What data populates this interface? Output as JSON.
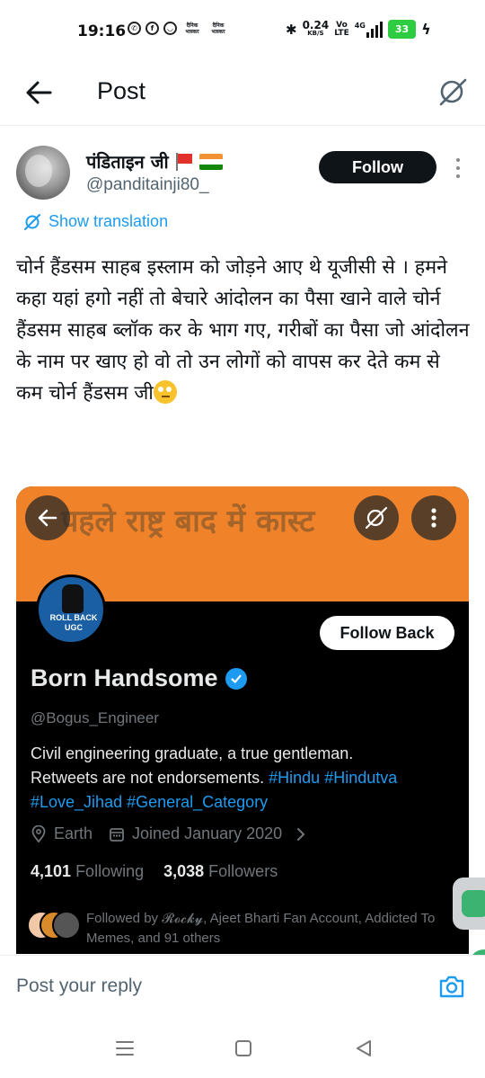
{
  "status_bar": {
    "time": "19:16",
    "net_speed": "0.24",
    "net_unit": "KB/S",
    "vo": "Vo",
    "lte": "LTE",
    "net_type": "4G",
    "battery": "33",
    "mini_app_label": "दैनिक भास्कर"
  },
  "header": {
    "title": "Post"
  },
  "post": {
    "author_name": "पंडिताइन जी",
    "author_handle": "@panditainji80_",
    "follow_label": "Follow",
    "show_translation": "Show translation",
    "text": "चोर्न हैंडसम साहब इस्लाम को जोड़ने आए थे यूजीसी से । हमने कहा यहां हगो नहीं तो बेचारे आंदोलन का पैसा खाने वाले चोर्न हैंडसम साहब ब्लॉक कर के भाग गए, गरीबों का पैसा जो आंदोलन के नाम पर खाए हो वो तो उन लोगों को वापस कर देते कम से कम चोर्न हैंडसम जी",
    "emoji": "eye-roll-emoji"
  },
  "embed": {
    "banner_text": "पहले राष्ट्र बाद में कास्ट",
    "avatar_label_line1": "ROLL BACK",
    "avatar_label_line2": "UGC",
    "follow_back_label": "Follow Back",
    "name": "Born Handsome",
    "handle": "@Bogus_Engineer",
    "bio_line1": "Civil engineering graduate, a true gentleman.",
    "bio_line2": "Retweets are not endorsements.",
    "hashtags_line2": "#Hindu #Hindutva",
    "hashtags_line3": "#Love_Jihad #General_Category",
    "location": "Earth",
    "joined": "Joined January 2020",
    "following_count": "4,101",
    "following_label": "Following",
    "followers_count": "3,038",
    "followers_label": "Followers",
    "followed_by": "Followed by 𝓡𝓸𝓬𝓴𝔂, Ajeet Bharti Fan Account, Addicted To Memes, and 91 others"
  },
  "reply": {
    "placeholder": "Post your reply"
  },
  "colors": {
    "accent": "#1d9bf0",
    "banner": "#f0822a",
    "battery": "#2ecc40"
  }
}
